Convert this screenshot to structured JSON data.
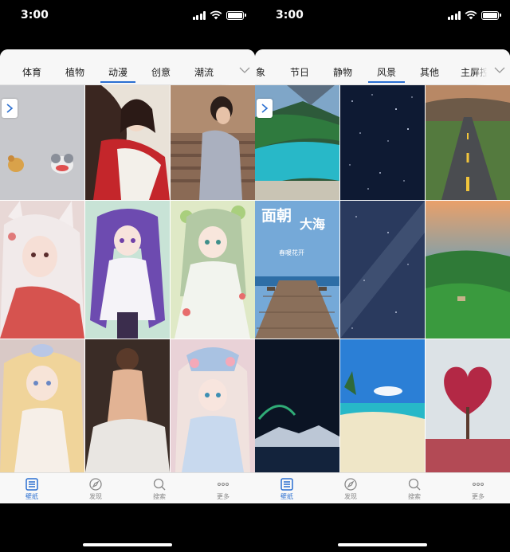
{
  "status_bar": {
    "time": "3:00"
  },
  "left_screen": {
    "tabs": [
      {
        "label": "体育",
        "active": false
      },
      {
        "label": "植物",
        "active": false
      },
      {
        "label": "动漫",
        "active": true
      },
      {
        "label": "创意",
        "active": false
      },
      {
        "label": "潮流",
        "active": false
      }
    ]
  },
  "right_screen": {
    "tabs": [
      {
        "label": "象",
        "active": false
      },
      {
        "label": "节日",
        "active": false
      },
      {
        "label": "静物",
        "active": false
      },
      {
        "label": "风景",
        "active": true
      },
      {
        "label": "其他",
        "active": false
      },
      {
        "label": "主屏控",
        "active": false
      }
    ],
    "poster": {
      "title_1": "面朝",
      "title_2": "大海",
      "subtitle": "春暖花开"
    }
  },
  "bottom_nav": [
    {
      "label": "壁纸",
      "icon": "wallpaper-icon",
      "active": true
    },
    {
      "label": "发现",
      "icon": "compass-icon",
      "active": false
    },
    {
      "label": "搜索",
      "icon": "search-icon",
      "active": false
    },
    {
      "label": "更多",
      "icon": "more-icon",
      "active": false
    }
  ],
  "colors": {
    "accent": "#2b6fd1",
    "inactive": "#888888"
  }
}
